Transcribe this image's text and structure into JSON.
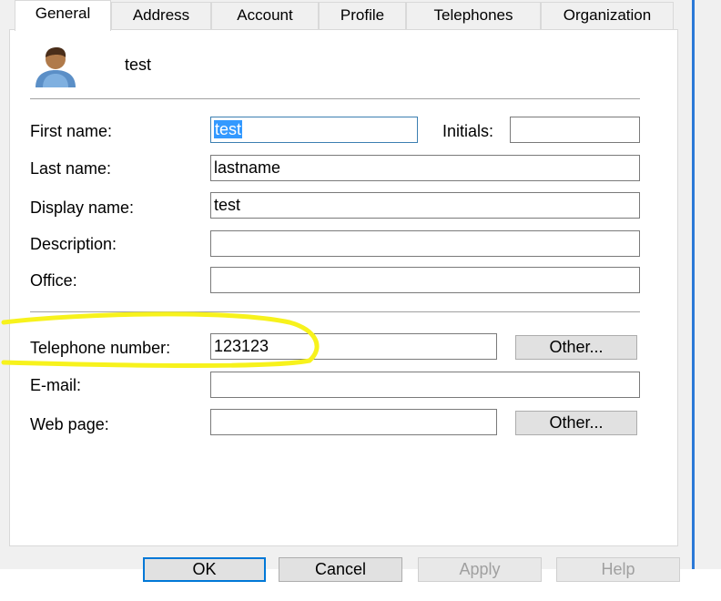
{
  "tabs": [
    {
      "label": "General",
      "active": true
    },
    {
      "label": "Address"
    },
    {
      "label": "Account"
    },
    {
      "label": "Profile"
    },
    {
      "label": "Telephones"
    },
    {
      "label": "Organization"
    }
  ],
  "header": {
    "name": "test",
    "icon": "user-icon"
  },
  "form": {
    "first_name_label": "First name:",
    "first_name_value": "test",
    "initials_label": "Initials:",
    "initials_value": "",
    "last_name_label": "Last name:",
    "last_name_value": "lastname",
    "display_name_label": "Display name:",
    "display_name_value": "test",
    "description_label": "Description:",
    "description_value": "",
    "office_label": "Office:",
    "office_value": "",
    "telephone_label": "Telephone number:",
    "telephone_value": "123123",
    "telephone_other_label": "Other...",
    "email_label": "E-mail:",
    "email_value": "",
    "webpage_label": "Web page:",
    "webpage_value": "",
    "webpage_other_label": "Other..."
  },
  "footer": {
    "ok_label": "OK",
    "cancel_label": "Cancel",
    "apply_label": "Apply",
    "help_label": "Help"
  },
  "colors": {
    "highlight": "#f7f21c",
    "accent": "#0078d7",
    "selection": "#3399ff"
  }
}
